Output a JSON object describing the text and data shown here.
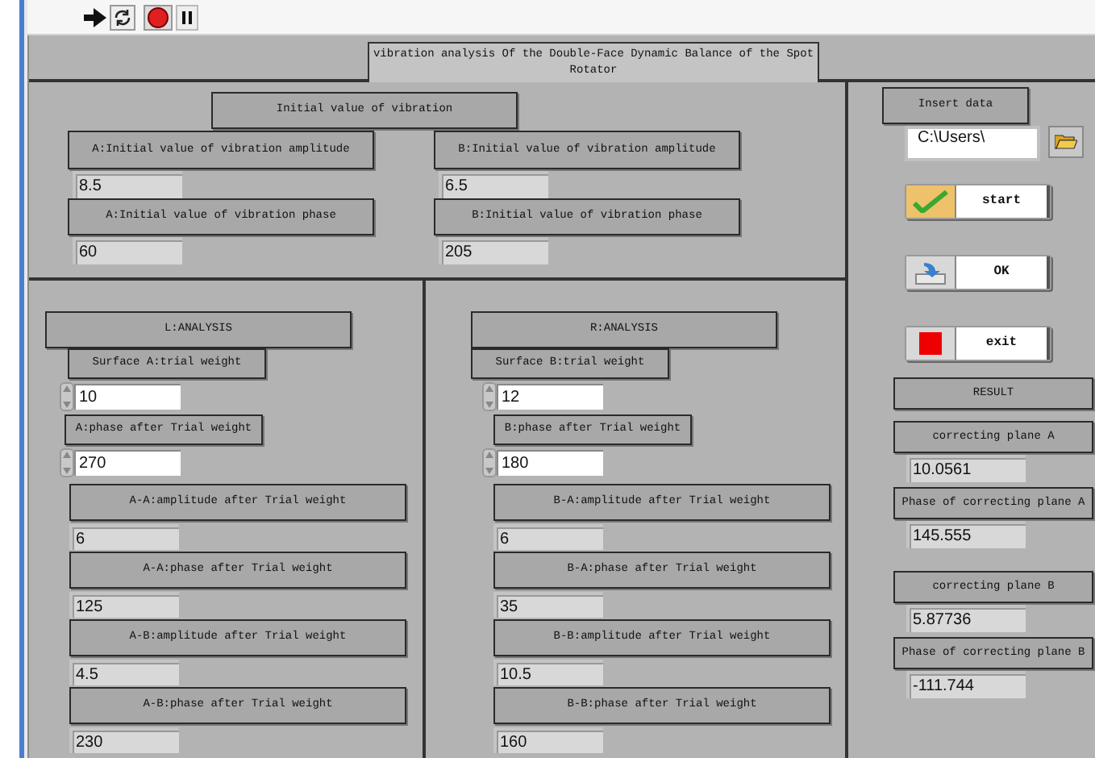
{
  "title": "vibration analysis Of the Double-Face Dynamic Balance of the Spot Rotator",
  "initial": {
    "heading": "Initial value of vibration",
    "columns": [
      {
        "amplitude_label": "A:Initial value of vibration amplitude",
        "amplitude": "8.5",
        "phase_label": "A:Initial value of vibration phase",
        "phase": "60"
      },
      {
        "amplitude_label": "B:Initial value of vibration amplitude",
        "amplitude": "6.5",
        "phase_label": "B:Initial value of vibration phase",
        "phase": "205"
      }
    ]
  },
  "analysis": [
    {
      "heading": "L:ANALYSIS",
      "weight_label": "Surface A:trial weight",
      "weight": "10",
      "phase_label": "A:phase after Trial weight",
      "phase": "270",
      "readings": [
        {
          "label": "A-A:amplitude after Trial weight",
          "value": "6"
        },
        {
          "label": "A-A:phase after Trial weight",
          "value": "125"
        },
        {
          "label": "A-B:amplitude after Trial weight",
          "value": "4.5"
        },
        {
          "label": "A-B:phase after Trial weight",
          "value": "230"
        }
      ]
    },
    {
      "heading": "R:ANALYSIS",
      "weight_label": "Surface B:trial weight",
      "weight": "12",
      "phase_label": "B:phase after Trial weight",
      "phase": "180",
      "readings": [
        {
          "label": "B-A:amplitude after Trial weight",
          "value": "6"
        },
        {
          "label": "B-A:phase after Trial weight",
          "value": "35"
        },
        {
          "label": "B-B:amplitude after Trial weight",
          "value": "10.5"
        },
        {
          "label": "B-B:phase after Trial weight",
          "value": "160"
        }
      ]
    }
  ],
  "insert_data": {
    "label": "Insert data",
    "path": "C:\\Users\\"
  },
  "buttons": [
    {
      "kind": "start",
      "label": "start"
    },
    {
      "kind": "ok",
      "label": "OK"
    },
    {
      "kind": "exit",
      "label": "exit"
    }
  ],
  "result": {
    "heading": "RESULT",
    "items": [
      {
        "label": "correcting plane A",
        "value": "10.0561"
      },
      {
        "label": "Phase of correcting plane A",
        "value": "145.555"
      },
      {
        "label": "correcting plane B",
        "value": "5.87736"
      },
      {
        "label": "Phase of correcting plane B",
        "value": "-111.744"
      }
    ]
  }
}
